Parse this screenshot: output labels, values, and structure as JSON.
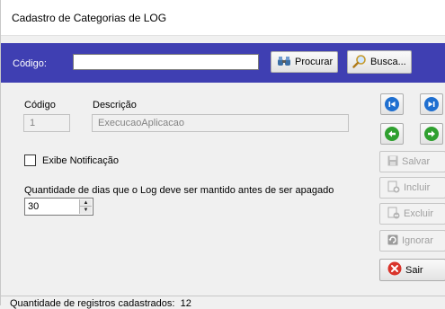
{
  "window": {
    "title": "Cadastro de Categorias de LOG"
  },
  "search": {
    "label": "Código:",
    "value": "",
    "procurar_label": "Procurar",
    "busca_label": "Busca..."
  },
  "form": {
    "codigo_label": "Código",
    "codigo_value": "1",
    "descricao_label": "Descrição",
    "descricao_value": "ExecucaoAplicacao",
    "notify_label": "Exibe Notificação",
    "notify_checked": false,
    "days_label": "Quantidade de dias que o Log deve ser mantido antes de ser apagado",
    "days_value": "30"
  },
  "nav": {
    "first_icon": "first-record-icon",
    "last_icon": "last-record-icon",
    "prev_icon": "previous-record-icon",
    "next_icon": "next-record-icon"
  },
  "actions": {
    "salvar": "Salvar",
    "incluir": "Incluir",
    "excluir": "Excluir",
    "ignorar": "Ignorar",
    "sair": "Sair"
  },
  "status": {
    "label": "Quantidade de registros cadastrados:",
    "count": "12"
  },
  "colors": {
    "search_bar": "#3f3fb2",
    "nav_blue": "#1f6fd0",
    "nav_green": "#2fa02f",
    "exit_red": "#d9342b"
  }
}
